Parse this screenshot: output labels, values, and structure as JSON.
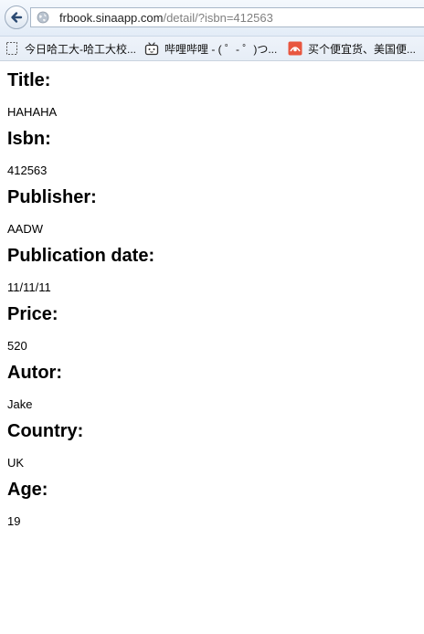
{
  "browser": {
    "url_host": "frbook.sinaapp.com",
    "url_path": "/detail/?isbn=412563",
    "bookmarks": [
      {
        "label": "今日哈工大-哈工大校...",
        "icon": "page-icon"
      },
      {
        "label": "哔哩哔哩 - ( ゜- ゜)つ...",
        "icon": "bilibili-tv-icon"
      },
      {
        "label": "买个便宜货、美国便...",
        "icon": "shopping-site-icon"
      }
    ]
  },
  "book": {
    "fields": [
      {
        "label": "Title:",
        "value": "HAHAHA"
      },
      {
        "label": "Isbn:",
        "value": "412563"
      },
      {
        "label": "Publisher:",
        "value": "AADW"
      },
      {
        "label": "Publication date:",
        "value": "11/11/11"
      },
      {
        "label": "Price:",
        "value": "520"
      },
      {
        "label": "Autor:",
        "value": "Jake"
      },
      {
        "label": "Country:",
        "value": "UK"
      },
      {
        "label": "Age:",
        "value": "19"
      }
    ]
  }
}
